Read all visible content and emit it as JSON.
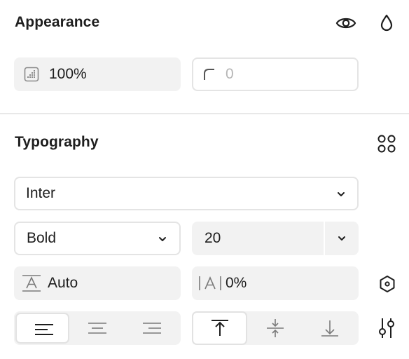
{
  "appearance": {
    "title": "Appearance",
    "opacity_value": "100%",
    "radius_value": "0",
    "icons": [
      "eye-icon",
      "droplet-icon",
      "opacity-icon",
      "corner-radius-icon"
    ]
  },
  "typography": {
    "title": "Typography",
    "font_family": "Inter",
    "font_weight": "Bold",
    "font_size": "20",
    "line_height": "Auto",
    "letter_spacing": "0%",
    "icons": [
      "styles-grid-icon",
      "line-height-icon",
      "letter-spacing-icon",
      "hexagon-icon",
      "sliders-icon",
      "chevron-down-icon"
    ],
    "text_align": {
      "options": [
        "left",
        "center",
        "right"
      ],
      "selected": "left"
    },
    "vertical_align": {
      "options": [
        "top",
        "middle",
        "bottom"
      ],
      "selected": "top"
    }
  }
}
